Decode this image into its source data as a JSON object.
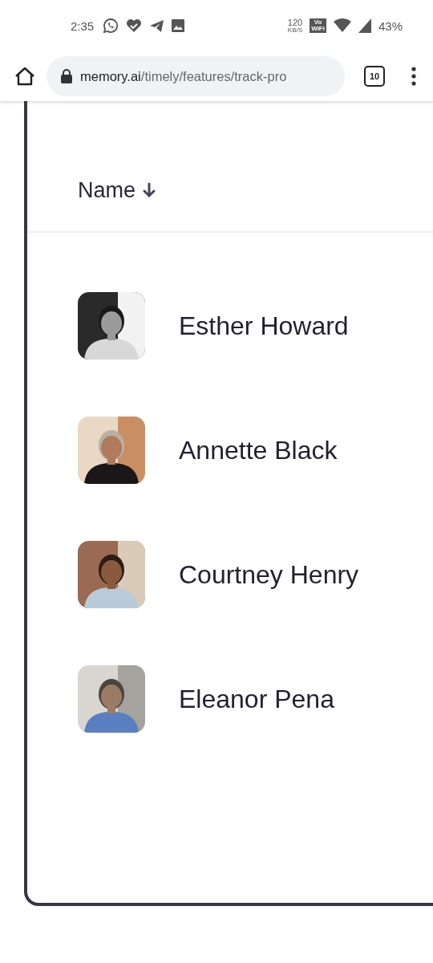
{
  "status_bar": {
    "time": "2:35",
    "net_speed": "120",
    "net_unit": "KB/S",
    "wifi_calling": [
      "Vo",
      "WiFi"
    ],
    "battery": "43%"
  },
  "browser": {
    "url_host": "memory.ai",
    "url_path": "/timely/features/track-pro",
    "tab_count": "10"
  },
  "table": {
    "column": {
      "label": "Name",
      "sorted_descending": true
    },
    "rows": [
      {
        "name": "Esther Howard"
      },
      {
        "name": "Annette Black"
      },
      {
        "name": "Courtney Henry"
      },
      {
        "name": "Eleanor Pena"
      }
    ]
  }
}
